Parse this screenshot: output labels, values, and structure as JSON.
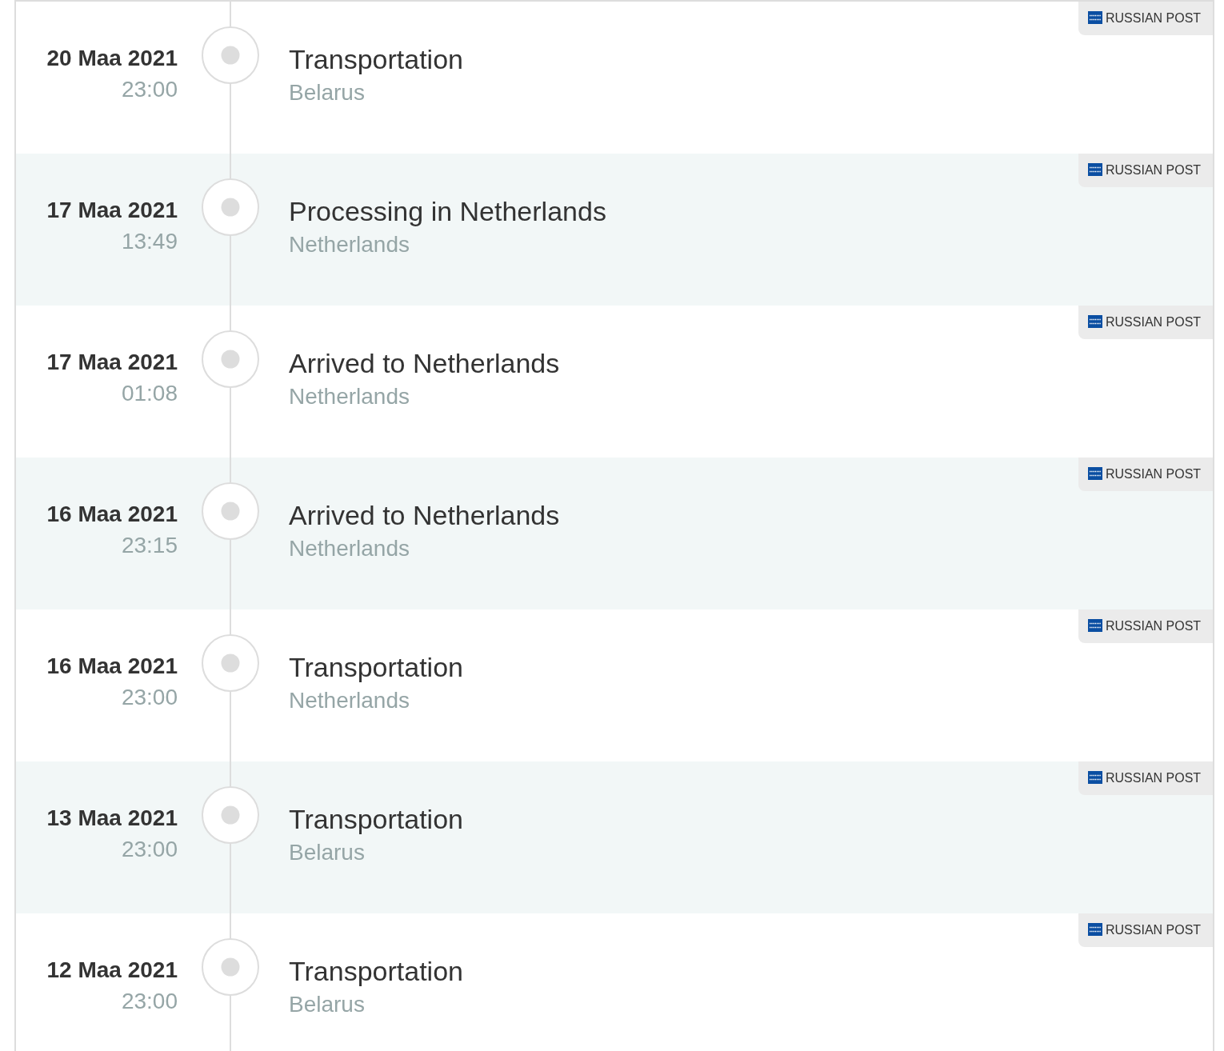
{
  "events": [
    {
      "date": "20 Maa 2021",
      "time": "23:00",
      "status": "Transportation",
      "location": "Belarus",
      "carrier": "RUSSIAN POST"
    },
    {
      "date": "17 Maa 2021",
      "time": "13:49",
      "status": "Processing in Netherlands",
      "location": "Netherlands",
      "carrier": "RUSSIAN POST"
    },
    {
      "date": "17 Maa 2021",
      "time": "01:08",
      "status": "Arrived to Netherlands",
      "location": "Netherlands",
      "carrier": "RUSSIAN POST"
    },
    {
      "date": "16 Maa 2021",
      "time": "23:15",
      "status": "Arrived to Netherlands",
      "location": "Netherlands",
      "carrier": "RUSSIAN POST"
    },
    {
      "date": "16 Maa 2021",
      "time": "23:00",
      "status": "Transportation",
      "location": "Netherlands",
      "carrier": "RUSSIAN POST"
    },
    {
      "date": "13 Maa 2021",
      "time": "23:00",
      "status": "Transportation",
      "location": "Belarus",
      "carrier": "RUSSIAN POST"
    },
    {
      "date": "12 Maa 2021",
      "time": "23:00",
      "status": "Transportation",
      "location": "Belarus",
      "carrier": "RUSSIAN POST"
    }
  ]
}
